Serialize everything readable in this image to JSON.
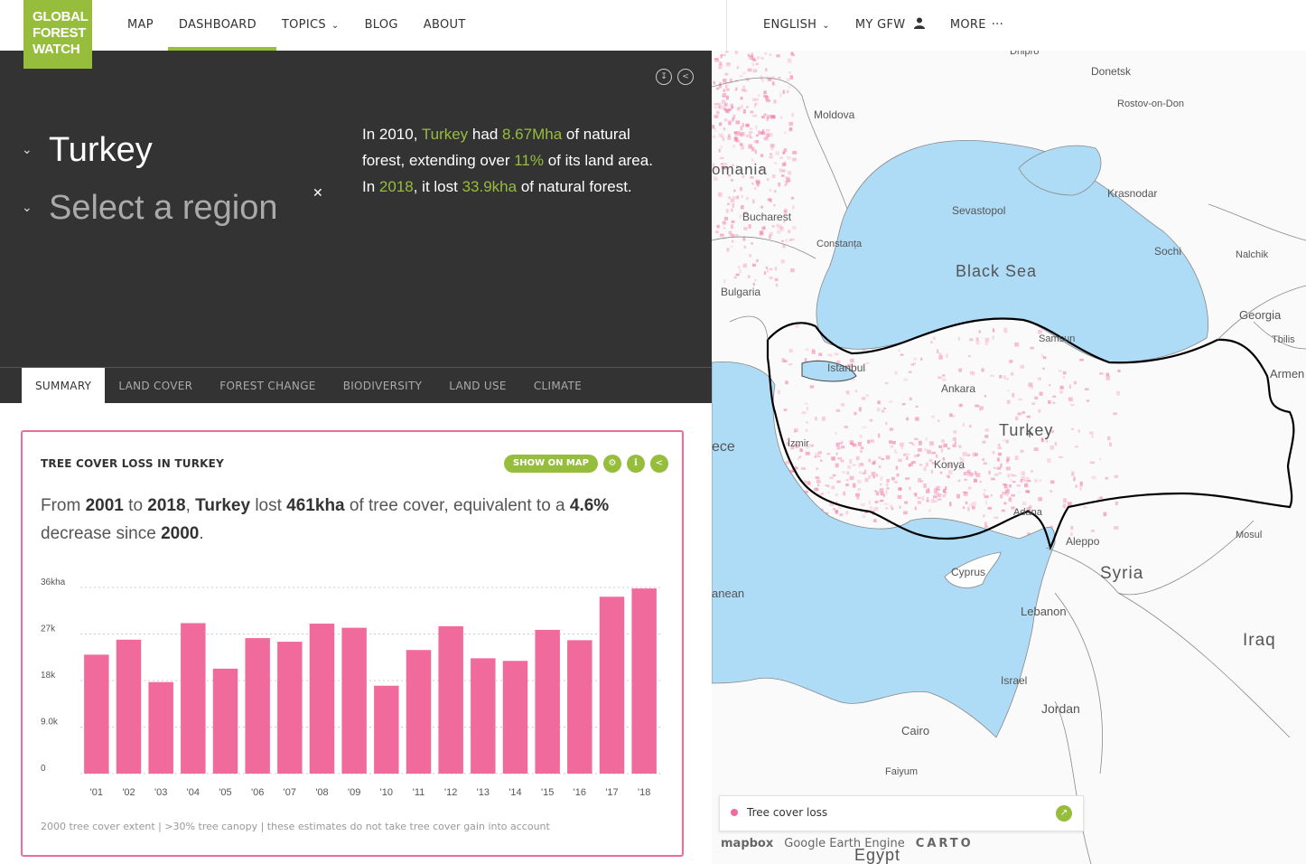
{
  "header": {
    "logo": [
      "GLOBAL",
      "FOREST",
      "WATCH"
    ],
    "nav": [
      "MAP",
      "DASHBOARD",
      "TOPICS",
      "BLOG",
      "ABOUT"
    ],
    "nav_right": [
      "ENGLISH",
      "MY GFW",
      "MORE"
    ]
  },
  "location": {
    "country": "Turkey",
    "region_placeholder": "Select a region",
    "summary": {
      "p1": "In 2010, ",
      "country": "Turkey",
      "p2": " had ",
      "extent": "8.67Mha",
      "p3": " of natural forest, extending over ",
      "pct": "11%",
      "p4": " of its land area. In ",
      "year": "2018",
      "p5": ", it lost ",
      "loss": "33.9kha",
      "p6": " of natural forest."
    }
  },
  "tabs": [
    "SUMMARY",
    "LAND COVER",
    "FOREST CHANGE",
    "BIODIVERSITY",
    "LAND USE",
    "CLIMATE"
  ],
  "widget": {
    "title": "TREE COVER LOSS IN TURKEY",
    "show_on_map": "SHOW ON MAP",
    "sentence": {
      "s1": "From ",
      "y1": "2001",
      "s2": " to ",
      "y2": "2018",
      "s3": ", ",
      "country": "Turkey",
      "s4": " lost ",
      "loss": "461kha",
      "s5": " of tree cover, equivalent to a ",
      "pct": "4.6%",
      "s6": " decrease since ",
      "y0": "2000",
      "s7": "."
    },
    "footnote": "2000 tree cover extent | >30% tree canopy | these estimates do not take tree cover gain into account"
  },
  "chart_data": {
    "type": "bar",
    "categories": [
      "'01",
      "'02",
      "'03",
      "'04",
      "'05",
      "'06",
      "'07",
      "'08",
      "'09",
      "'10",
      "'11",
      "'12",
      "'13",
      "'14",
      "'15",
      "'16",
      "'17",
      "'18"
    ],
    "values": [
      23.0,
      25.9,
      17.7,
      29.1,
      20.3,
      26.2,
      25.5,
      29.0,
      28.2,
      17.0,
      23.9,
      28.5,
      22.3,
      21.8,
      27.8,
      25.8,
      34.2,
      35.8
    ],
    "ytick_labels": [
      "0",
      "9.0k",
      "18k",
      "27k",
      "36kha"
    ],
    "yticks": [
      0,
      9,
      18,
      27,
      36
    ],
    "ylim": [
      0,
      36
    ],
    "unit": "kha",
    "color": "#f06a9b"
  },
  "map": {
    "labels": [
      {
        "text": "Dnipro"
      },
      {
        "text": "Donetsk"
      },
      {
        "text": "Moldova"
      },
      {
        "text": "Rostov-on-Don"
      },
      {
        "text": "omania"
      },
      {
        "text": "Krasnodar"
      },
      {
        "text": "Sevastopol"
      },
      {
        "text": "Bucharest"
      },
      {
        "text": "Constanța"
      },
      {
        "text": "Sochi"
      },
      {
        "text": "Nalchik"
      },
      {
        "text": "Black Sea"
      },
      {
        "text": "Bulgaria"
      },
      {
        "text": "Georgia"
      },
      {
        "text": "Tbilis"
      },
      {
        "text": "Samsun"
      },
      {
        "text": "Istanbul"
      },
      {
        "text": "Armen"
      },
      {
        "text": "Ankara"
      },
      {
        "text": "Turkey"
      },
      {
        "text": "İzmir"
      },
      {
        "text": "ece"
      },
      {
        "text": "Konya"
      },
      {
        "text": "Adana"
      },
      {
        "text": "Aleppo"
      },
      {
        "text": "Mosul"
      },
      {
        "text": "Cyprus"
      },
      {
        "text": "Syria"
      },
      {
        "text": "anean"
      },
      {
        "text": "Lebanon"
      },
      {
        "text": "Iraq"
      },
      {
        "text": "Israel"
      },
      {
        "text": "Jordan"
      },
      {
        "text": "Cairo"
      },
      {
        "text": "Faiyum"
      },
      {
        "text": "Egypt"
      }
    ],
    "legend_label": "Tree cover loss",
    "attribution": [
      "mapbox",
      "Google Earth Engine",
      "CARTO"
    ],
    "colors": {
      "water": "#aedcf7",
      "land": "#fafafa",
      "loss": "#f06a9b"
    }
  }
}
